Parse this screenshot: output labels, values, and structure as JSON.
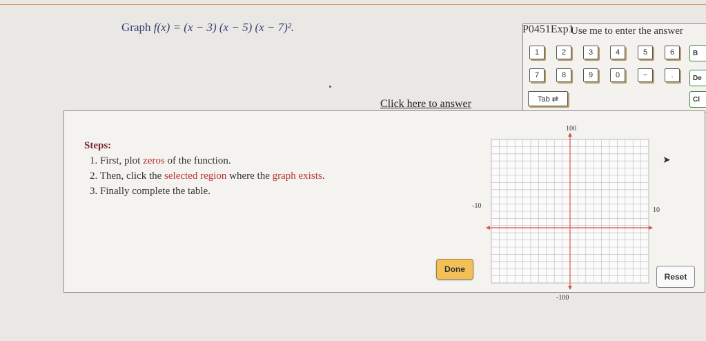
{
  "problem": {
    "prefix": "Graph",
    "function": "f(x) = (x − 3) (x − 5) (x − 7)².",
    "code": "P0451Exp1"
  },
  "answer_link": "Click here to answer",
  "steps": {
    "heading": "Steps:",
    "item1_pre": "1. First, plot ",
    "item1_hl": "zeros",
    "item1_post": " of the function.",
    "item2_pre": "2. Then, click the ",
    "item2_hl1": "selected region",
    "item2_mid": " where the ",
    "item2_hl2": "graph exists",
    "item2_post": ".",
    "item3": "3. Finally complete the table."
  },
  "buttons": {
    "done": "Done",
    "reset": "Reset"
  },
  "keypad": {
    "hint": "Use me to enter the answer",
    "row1": [
      "1",
      "2",
      "3",
      "4",
      "5",
      "6"
    ],
    "row2": [
      "7",
      "8",
      "9",
      "0",
      "−",
      "."
    ],
    "tab": "Tab ⇄",
    "side": [
      "B",
      "De",
      "Cl"
    ]
  },
  "graph": {
    "x_min_label": "-10",
    "x_max_label": "10",
    "y_max_label": "100",
    "y_min_label": "-100",
    "axis_color": "#d9534f",
    "grid_color": "#b9b9b9"
  }
}
